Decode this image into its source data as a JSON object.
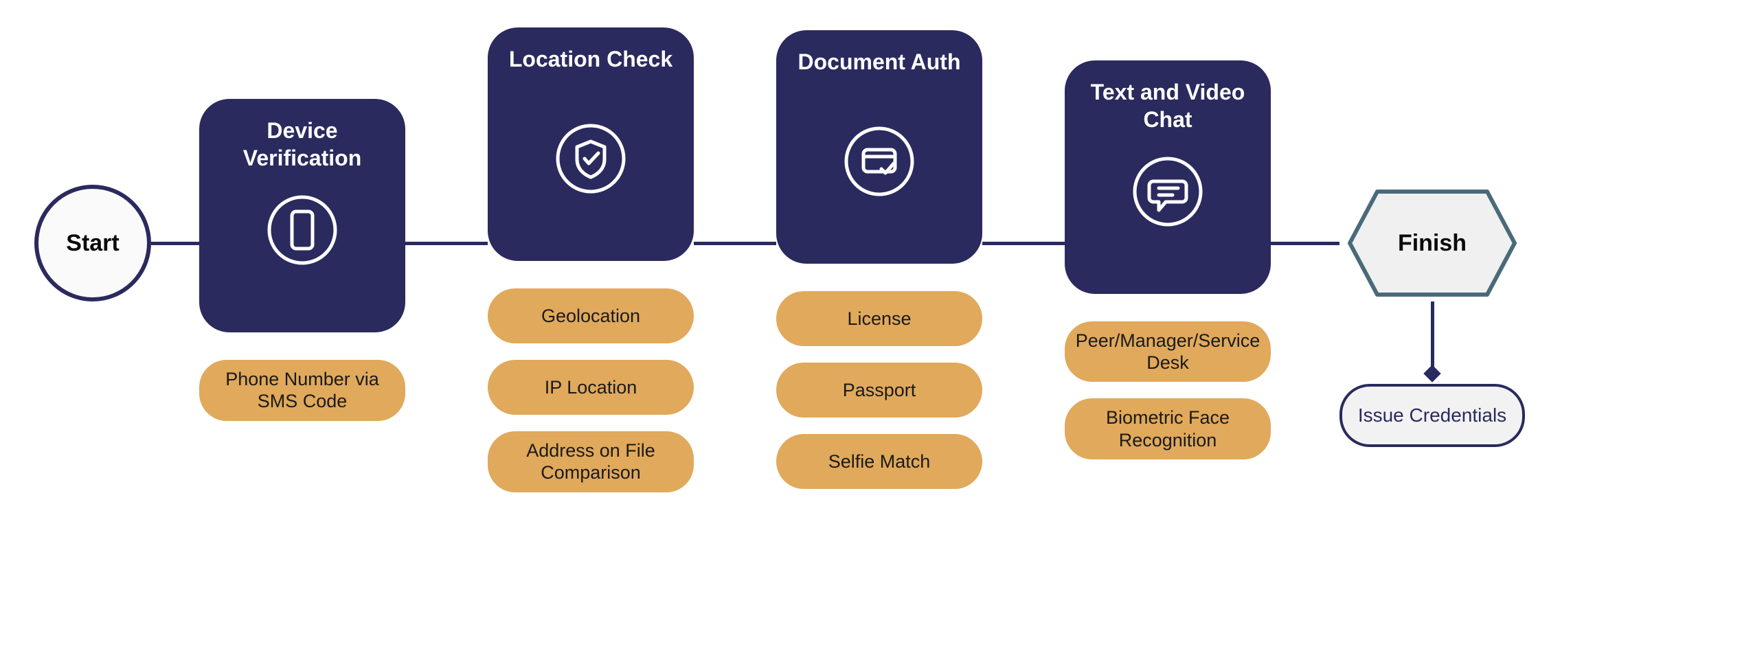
{
  "start": {
    "label": "Start"
  },
  "stages": [
    {
      "title": "Device Verification",
      "icon": "phone-icon",
      "items": [
        "Phone Number via SMS Code"
      ]
    },
    {
      "title": "Location Check",
      "icon": "shield-check-icon",
      "items": [
        "Geolocation",
        "IP Location",
        "Address on File Comparison"
      ]
    },
    {
      "title": "Document Auth",
      "icon": "card-check-icon",
      "items": [
        "License",
        "Passport",
        "Selfie Match"
      ]
    },
    {
      "title": "Text and Video Chat",
      "icon": "chat-icon",
      "items": [
        "Peer/Manager/Service Desk",
        "Biometric Face Recognition"
      ]
    }
  ],
  "finish": {
    "label": "Finish",
    "issue_label": "Issue Credentials"
  },
  "colors": {
    "stage_bg": "#2a2a5e",
    "pill_bg": "#e0a95b",
    "border": "#2a2a5e",
    "hex_border": "#4a6a7a"
  }
}
